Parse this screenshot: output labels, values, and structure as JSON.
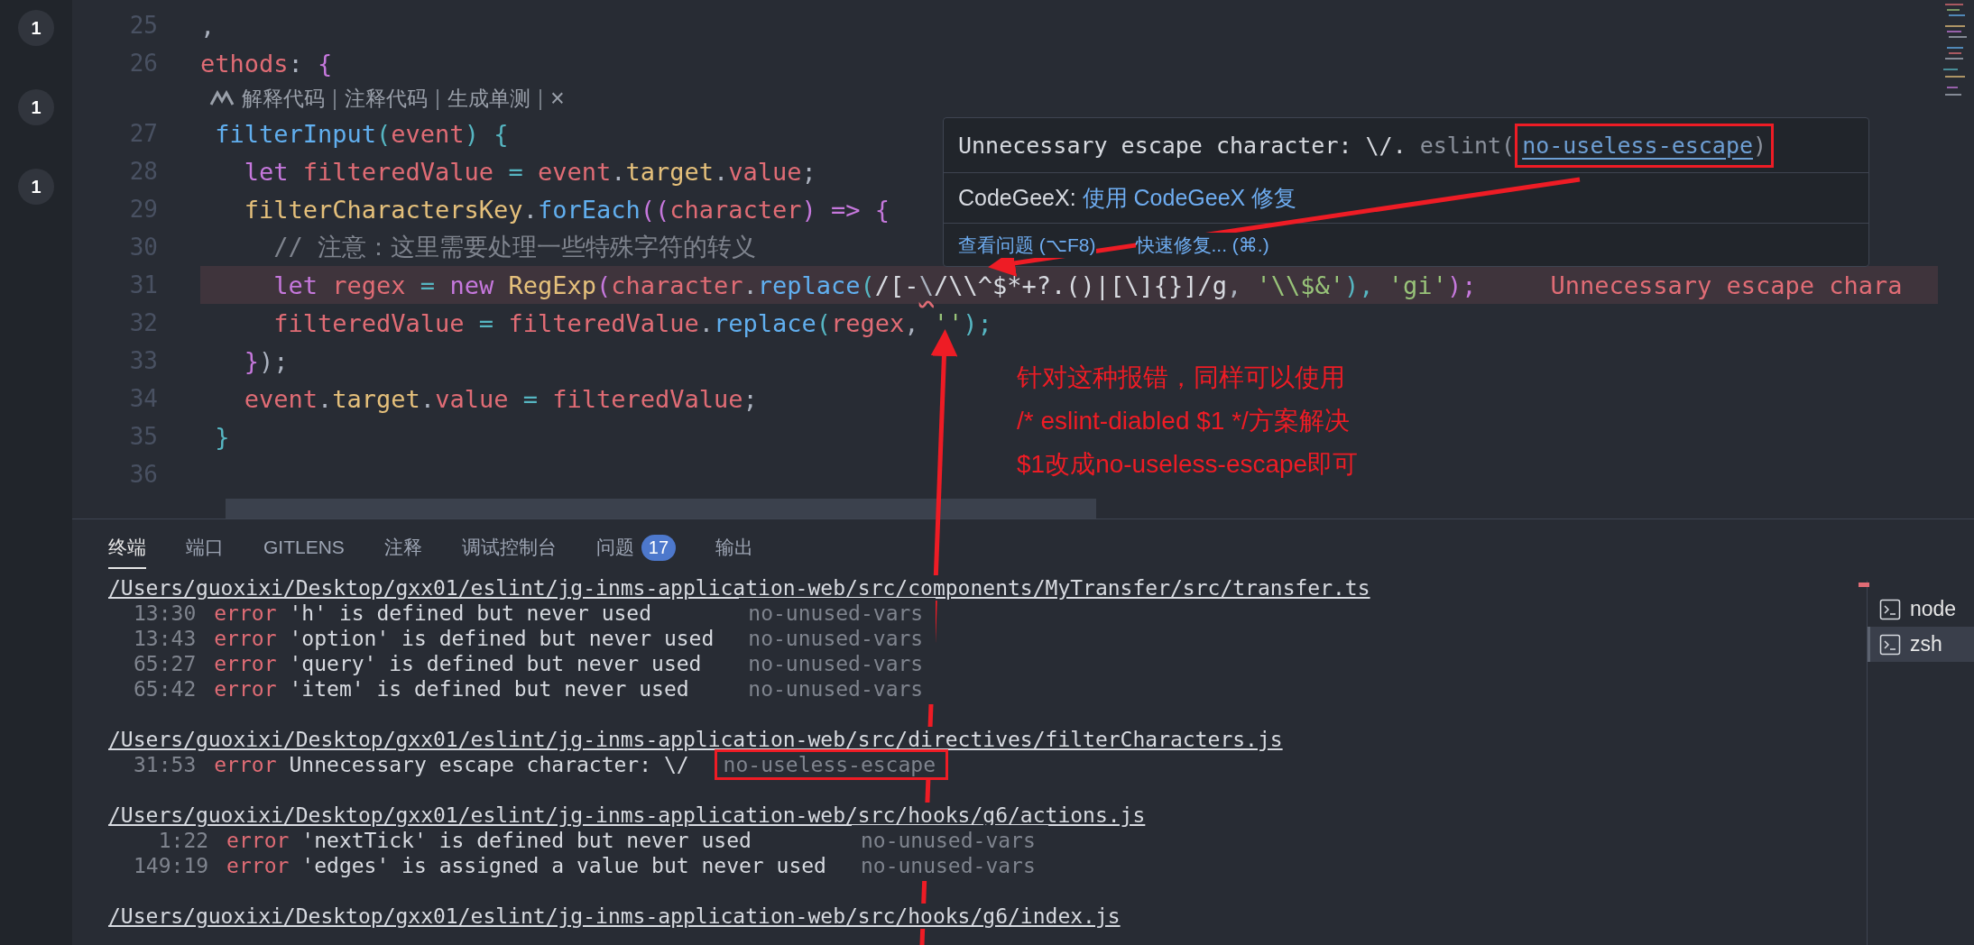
{
  "activity_badges": [
    "1",
    "1",
    "1"
  ],
  "editor": {
    "lines": [
      {
        "kind": "code",
        "number": "25",
        "error": false,
        "tokens": [
          {
            "text": ",",
            "kind": "punct"
          }
        ]
      },
      {
        "kind": "code",
        "number": "26",
        "error": false,
        "tokens": [
          {
            "text": "ethods",
            "kind": "var"
          },
          {
            "text": ": ",
            "kind": "punct"
          },
          {
            "text": "{",
            "kind": "kw"
          }
        ]
      },
      {
        "kind": "lens",
        "items": [
          {
            "text": "解释代码",
            "kind": "action"
          },
          {
            "text": "|",
            "kind": "separator"
          },
          {
            "text": "注释代码",
            "kind": "action"
          },
          {
            "text": "|",
            "kind": "separator"
          },
          {
            "text": "生成单测",
            "kind": "action"
          },
          {
            "text": "|",
            "kind": "separator"
          },
          {
            "text": "×",
            "kind": "close"
          }
        ]
      },
      {
        "kind": "code",
        "number": "27",
        "error": false,
        "tokens": [
          {
            "text": " filterInput",
            "kind": "fn"
          },
          {
            "text": "(",
            "kind": "op"
          },
          {
            "text": "event",
            "kind": "var"
          },
          {
            "text": ") {",
            "kind": "op"
          }
        ]
      },
      {
        "kind": "code",
        "number": "28",
        "error": false,
        "tokens": [
          {
            "text": "   let",
            "kind": "kw"
          },
          {
            "text": " filteredValue",
            "kind": "var"
          },
          {
            "text": " = ",
            "kind": "op"
          },
          {
            "text": "event",
            "kind": "var"
          },
          {
            "text": ".",
            "kind": "punct"
          },
          {
            "text": "target",
            "kind": "cls"
          },
          {
            "text": ".",
            "kind": "punct"
          },
          {
            "text": "value",
            "kind": "var"
          },
          {
            "text": ";",
            "kind": "punct"
          }
        ]
      },
      {
        "kind": "code",
        "number": "29",
        "error": false,
        "tokens": [
          {
            "text": "   filterCharactersKey",
            "kind": "cls"
          },
          {
            "text": ".",
            "kind": "punct"
          },
          {
            "text": "forEach",
            "kind": "fn"
          },
          {
            "text": "((",
            "kind": "kw"
          },
          {
            "text": "character",
            "kind": "var"
          },
          {
            "text": ")",
            "kind": "kw"
          },
          {
            "text": " => ",
            "kind": "kw"
          },
          {
            "text": "{",
            "kind": "kw"
          }
        ]
      },
      {
        "kind": "code",
        "number": "30",
        "error": false,
        "tokens": [
          {
            "text": "     // 注意：这里需要处理一些特殊字符的转义",
            "kind": "comment"
          }
        ]
      },
      {
        "kind": "code",
        "number": "31",
        "error": true,
        "message": "Unnecessary escape chara",
        "tokens": [
          {
            "text": "     let",
            "kind": "kw"
          },
          {
            "text": " regex",
            "kind": "var"
          },
          {
            "text": " = ",
            "kind": "op"
          },
          {
            "text": "new",
            "kind": "kw"
          },
          {
            "text": " RegExp",
            "kind": "cls"
          },
          {
            "text": "(",
            "kind": "kw"
          },
          {
            "text": "character",
            "kind": "var"
          },
          {
            "text": ".",
            "kind": "punct"
          },
          {
            "text": "replace",
            "kind": "fn"
          },
          {
            "text": "(",
            "kind": "op"
          },
          {
            "text": "/[-",
            "kind": "regex"
          },
          {
            "text": "\\",
            "kind": "errchar"
          },
          {
            "text": "/\\\\^$*+?.()|[\\]{}]/g",
            "kind": "regex"
          },
          {
            "text": ", ",
            "kind": "punct"
          },
          {
            "text": "'\\\\$&'",
            "kind": "str"
          },
          {
            "text": "), ",
            "kind": "op"
          },
          {
            "text": "'gi'",
            "kind": "str"
          },
          {
            "text": ");",
            "kind": "kw"
          }
        ]
      },
      {
        "kind": "code",
        "number": "32",
        "error": false,
        "tokens": [
          {
            "text": "     filteredValue",
            "kind": "var"
          },
          {
            "text": " = ",
            "kind": "op"
          },
          {
            "text": "filteredValue",
            "kind": "var"
          },
          {
            "text": ".",
            "kind": "punct"
          },
          {
            "text": "replace",
            "kind": "fn"
          },
          {
            "text": "(",
            "kind": "op"
          },
          {
            "text": "regex",
            "kind": "var"
          },
          {
            "text": ", ",
            "kind": "punct"
          },
          {
            "text": "''",
            "kind": "str"
          },
          {
            "text": ");",
            "kind": "op"
          }
        ]
      },
      {
        "kind": "code",
        "number": "33",
        "error": false,
        "tokens": [
          {
            "text": "   }",
            "kind": "kw"
          },
          {
            "text": ");",
            "kind": "punct"
          }
        ]
      },
      {
        "kind": "code",
        "number": "34",
        "error": false,
        "tokens": [
          {
            "text": "   event",
            "kind": "var"
          },
          {
            "text": ".",
            "kind": "punct"
          },
          {
            "text": "target",
            "kind": "cls"
          },
          {
            "text": ".",
            "kind": "punct"
          },
          {
            "text": "value",
            "kind": "var"
          },
          {
            "text": " = ",
            "kind": "op"
          },
          {
            "text": "filteredValue",
            "kind": "var"
          },
          {
            "text": ";",
            "kind": "punct"
          }
        ]
      },
      {
        "kind": "code",
        "number": "35",
        "error": false,
        "tokens": [
          {
            "text": " }",
            "kind": "op"
          }
        ]
      },
      {
        "kind": "code",
        "number": "36",
        "error": false
      }
    ]
  },
  "hover": {
    "message": "Unnecessary escape character: \\/.",
    "source": " eslint(",
    "rule_link": "no-useless-escape",
    "close": ")",
    "boxed": true,
    "ai_label": "CodeGeeX: ",
    "ai_action": "使用 CodeGeeX 修复",
    "actions": [
      "查看问题 (⌥F8)",
      "快速修复... (⌘.)"
    ]
  },
  "panel": {
    "tabs": [
      {
        "label": "终端",
        "selected": true
      },
      {
        "label": "端口",
        "selected": false
      },
      {
        "label": "GITLENS",
        "selected": false
      },
      {
        "label": "注释",
        "selected": false
      },
      {
        "label": "调试控制台",
        "selected": false
      },
      {
        "label": "问题",
        "selected": false,
        "badge": "17"
      },
      {
        "label": "输出",
        "selected": false
      }
    ],
    "groups": [
      {
        "path": "/Users/guoxixi/Desktop/gxx01/eslint/jg-inms-application-web/src/components/MyTransfer/src/transfer.ts",
        "rows": [
          {
            "position": "13:30",
            "severity": "error",
            "message": "'h' is defined but never used",
            "rule": "no-unused-vars",
            "boxed": false
          },
          {
            "position": "13:43",
            "severity": "error",
            "message": "'option' is defined but never used",
            "rule": "no-unused-vars",
            "boxed": false
          },
          {
            "position": "65:27",
            "severity": "error",
            "message": "'query' is defined but never used",
            "rule": "no-unused-vars",
            "boxed": false
          },
          {
            "position": "65:42",
            "severity": "error",
            "message": "'item' is defined but never used",
            "rule": "no-unused-vars",
            "boxed": false
          }
        ]
      },
      {
        "path": "/Users/guoxixi/Desktop/gxx01/eslint/jg-inms-application-web/src/directives/filterCharacters.js",
        "rows": [
          {
            "position": "31:53",
            "severity": "error",
            "message": "Unnecessary escape character: \\/",
            "rule": "no-useless-escape",
            "boxed": true
          }
        ]
      },
      {
        "path": "/Users/guoxixi/Desktop/gxx01/eslint/jg-inms-application-web/src/hooks/g6/actions.js",
        "rows": [
          {
            "position": "1:22",
            "severity": "error",
            "message": "'nextTick' is defined but never used",
            "rule": "no-unused-vars",
            "boxed": false
          },
          {
            "position": "149:19",
            "severity": "error",
            "message": "'edges' is assigned a value but never used",
            "rule": "no-unused-vars",
            "boxed": false
          }
        ]
      },
      {
        "path": "/Users/guoxixi/Desktop/gxx01/eslint/jg-inms-application-web/src/hooks/g6/index.js"
      }
    ],
    "terminals": [
      {
        "label": "node",
        "selected": false
      },
      {
        "label": "zsh",
        "selected": true
      }
    ]
  },
  "annotation": {
    "lines": [
      "针对这种报错，同样可以使用",
      "/* eslint-diabled $1 */方案解决",
      "$1改成no-useless-escape即可"
    ]
  }
}
